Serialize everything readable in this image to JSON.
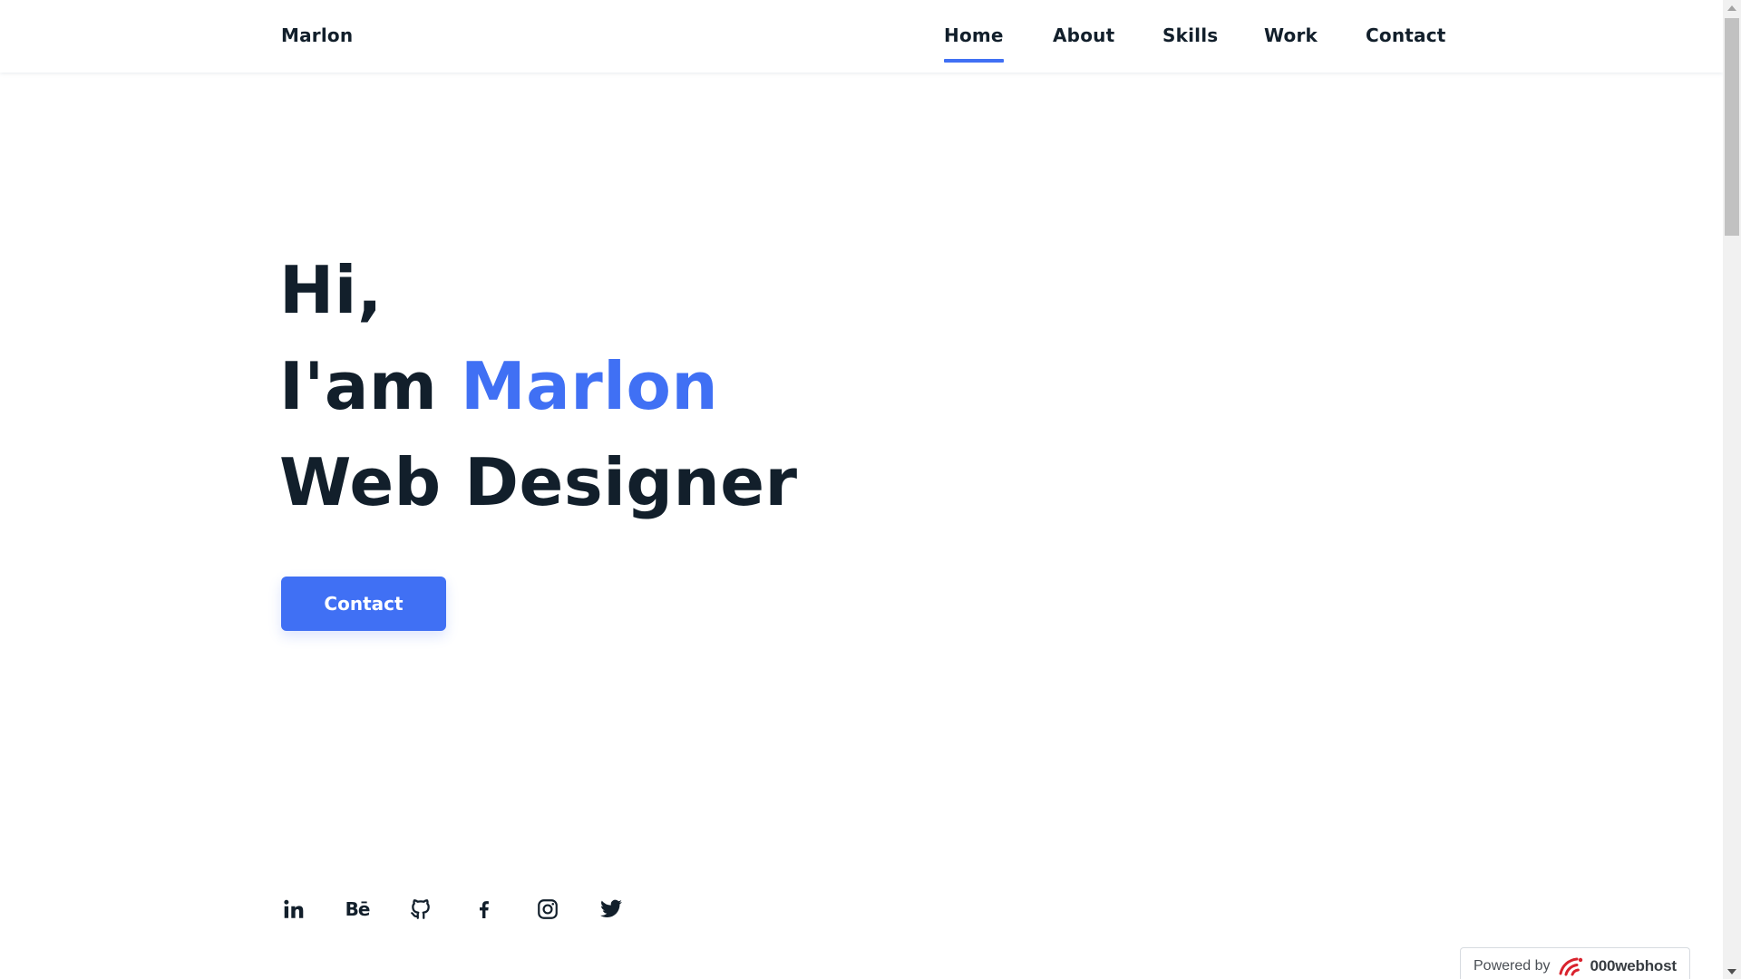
{
  "header": {
    "logo": "Marlon",
    "nav": [
      {
        "label": "Home",
        "active": true
      },
      {
        "label": "About",
        "active": false
      },
      {
        "label": "Skills",
        "active": false
      },
      {
        "label": "Work",
        "active": false
      },
      {
        "label": "Contact",
        "active": false
      }
    ]
  },
  "hero": {
    "greeting": "Hi,",
    "intro_prefix": "I'am ",
    "name": "Marlon",
    "role": "Web Designer",
    "button_label": "Contact"
  },
  "social": [
    {
      "name": "linkedin-icon",
      "text": "in"
    },
    {
      "name": "behance-icon",
      "text": "Bē"
    },
    {
      "name": "github-icon",
      "text": ""
    },
    {
      "name": "facebook-icon",
      "text": ""
    },
    {
      "name": "instagram-icon",
      "text": ""
    },
    {
      "name": "twitter-icon",
      "text": ""
    }
  ],
  "badge": {
    "powered_by": "Powered by",
    "brand": "000webhost"
  },
  "colors": {
    "accent": "#4070f4",
    "text": "#121f2b",
    "background": "#ffffff"
  }
}
